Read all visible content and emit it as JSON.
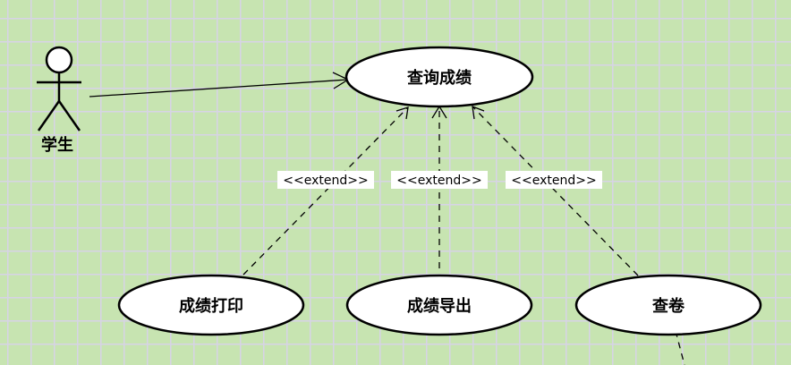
{
  "diagram": {
    "actor": {
      "label": "学生"
    },
    "use_cases": {
      "query": "查询成绩",
      "print": "成绩打印",
      "export": "成绩导出",
      "review": "查卷"
    },
    "extend_labels": [
      "<<extend>>",
      "<<extend>>",
      "<<extend>>"
    ]
  },
  "colors": {
    "background": "#c7e4b1",
    "grid": "#d7d3e6",
    "ellipse_fill": "#ffffff",
    "stroke": "#000000"
  }
}
